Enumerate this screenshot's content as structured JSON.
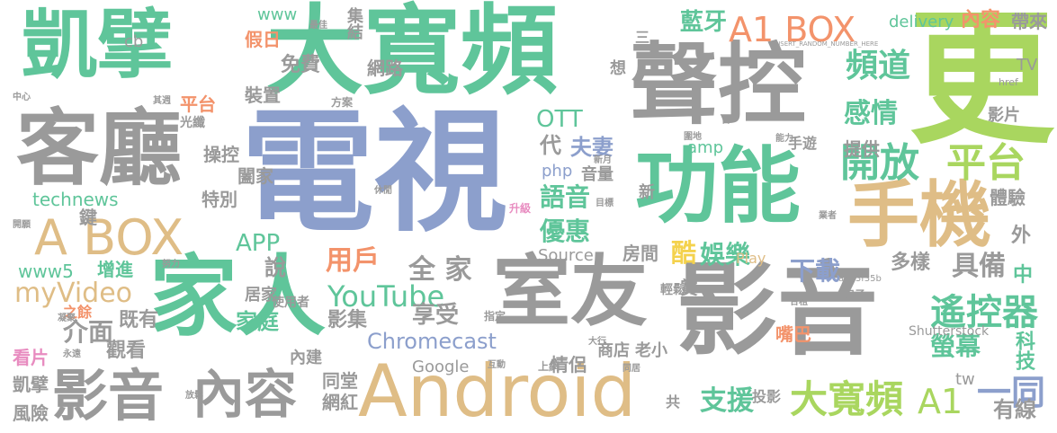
{
  "colors": {
    "gray": "#9a9a9a",
    "green": "#5fc59a",
    "blue": "#8c9fcc",
    "tan": "#dfbd86",
    "lime": "#a9d65f",
    "yellow": "#f4d24d",
    "orange": "#f3936b",
    "pink": "#e88cc0",
    "lightgray": "#c4c4c4"
  },
  "words": [
    {
      "text": "電視",
      "color": "blue"
    },
    {
      "text": "更",
      "color": "lime"
    },
    {
      "text": "影音",
      "color": "gray"
    },
    {
      "text": "大寬頻",
      "color": "green"
    },
    {
      "text": "凱擘",
      "color": "green"
    },
    {
      "text": "聲控",
      "color": "gray"
    },
    {
      "text": "家人",
      "color": "green"
    },
    {
      "text": "客廳",
      "color": "gray"
    },
    {
      "text": "功能",
      "color": "green"
    },
    {
      "text": "室友",
      "color": "gray"
    },
    {
      "text": "Android",
      "color": "tan"
    },
    {
      "text": "手機",
      "color": "tan"
    },
    {
      "text": "A BOX",
      "color": "tan"
    },
    {
      "text": "內容",
      "color": "gray"
    },
    {
      "text": "影音",
      "color": "gray"
    },
    {
      "text": "A1 BOX",
      "color": "orange"
    },
    {
      "text": "開放",
      "color": "green"
    },
    {
      "text": "平台",
      "color": "lime"
    },
    {
      "text": "遙控器",
      "color": "green"
    },
    {
      "text": "大寬頻",
      "color": "lime"
    },
    {
      "text": "A1",
      "color": "lime"
    },
    {
      "text": "一同",
      "color": "blue"
    },
    {
      "text": "YouTube",
      "color": "green"
    },
    {
      "text": "Chromecast",
      "color": "blue"
    },
    {
      "text": "myVideo",
      "color": "tan"
    },
    {
      "text": "technews",
      "color": "green"
    },
    {
      "text": "APP",
      "color": "green"
    },
    {
      "text": "OTT",
      "color": "green"
    },
    {
      "text": "藍牙",
      "color": "green"
    },
    {
      "text": "頻道",
      "color": "green"
    },
    {
      "text": "感情",
      "color": "green"
    },
    {
      "text": "語音",
      "color": "green"
    },
    {
      "text": "優惠",
      "color": "green"
    },
    {
      "text": "夫妻",
      "color": "blue"
    },
    {
      "text": "用戶",
      "color": "orange"
    },
    {
      "text": "全 家",
      "color": "gray"
    },
    {
      "text": "享受",
      "color": "gray"
    },
    {
      "text": "影集",
      "color": "gray"
    },
    {
      "text": "家庭",
      "color": "green"
    },
    {
      "text": "支援",
      "color": "green"
    },
    {
      "text": "娛樂",
      "color": "green"
    },
    {
      "text": "酷",
      "color": "yellow"
    },
    {
      "text": "房間",
      "color": "gray"
    },
    {
      "text": "下載",
      "color": "blue"
    },
    {
      "text": "螢幕",
      "color": "green"
    },
    {
      "text": "具備",
      "color": "gray"
    },
    {
      "text": "多樣",
      "color": "gray"
    },
    {
      "text": "科技",
      "color": "green"
    },
    {
      "text": "有線",
      "color": "gray"
    },
    {
      "text": "內容",
      "color": "orange"
    },
    {
      "text": "帶來",
      "color": "gray"
    },
    {
      "text": "delivery",
      "color": "green"
    },
    {
      "text": "集結",
      "color": "gray"
    },
    {
      "text": "www",
      "color": "green"
    },
    {
      "text": "網路",
      "color": "gray"
    },
    {
      "text": "免費",
      "color": "gray"
    },
    {
      "text": "假日",
      "color": "orange"
    },
    {
      "text": "裝置",
      "color": "gray"
    },
    {
      "text": "平台",
      "color": "orange"
    },
    {
      "text": "操控",
      "color": "gray"
    },
    {
      "text": "闔家",
      "color": "gray"
    },
    {
      "text": "特別",
      "color": "gray"
    },
    {
      "text": "說",
      "color": "gray"
    },
    {
      "text": "增進",
      "color": "green"
    },
    {
      "text": "www5",
      "color": "green"
    },
    {
      "text": "介面",
      "color": "gray"
    },
    {
      "text": "既有",
      "color": "gray"
    },
    {
      "text": "觀看",
      "color": "gray"
    },
    {
      "text": "凱擘",
      "color": "gray"
    },
    {
      "text": "風險",
      "color": "gray"
    },
    {
      "text": "看片",
      "color": "pink"
    },
    {
      "text": "內建",
      "color": "gray"
    },
    {
      "text": "同堂",
      "color": "gray"
    },
    {
      "text": "網紅",
      "color": "gray"
    },
    {
      "text": "Google",
      "color": "gray"
    },
    {
      "text": "情侶",
      "color": "gray"
    },
    {
      "text": "商店",
      "color": "gray"
    },
    {
      "text": "老小",
      "color": "gray"
    },
    {
      "text": "嘴巴",
      "color": "orange"
    },
    {
      "text": "Shutterstock",
      "color": "gray"
    },
    {
      "text": "使用者",
      "color": "gray"
    },
    {
      "text": "居家",
      "color": "gray"
    },
    {
      "text": "Source",
      "color": "gray"
    },
    {
      "text": "php",
      "color": "blue"
    },
    {
      "text": "音量",
      "color": "gray"
    },
    {
      "text": "amp",
      "color": "green"
    },
    {
      "text": "提供",
      "color": "gray"
    },
    {
      "text": "影片",
      "color": "gray"
    },
    {
      "text": "體驗",
      "color": "gray"
    },
    {
      "text": "TV",
      "color": "gray"
    },
    {
      "text": "中",
      "color": "green"
    },
    {
      "text": "tw",
      "color": "gray"
    },
    {
      "text": "外",
      "color": "gray"
    },
    {
      "text": "代",
      "color": "gray"
    },
    {
      "text": "鍵",
      "color": "gray"
    },
    {
      "text": "cb",
      "color": "gray"
    },
    {
      "text": "Play",
      "color": "tan"
    },
    {
      "text": "輕鬆",
      "color": "gray"
    },
    {
      "text": "賞",
      "color": "gray"
    },
    {
      "text": "手遊",
      "color": "gray"
    },
    {
      "text": "投影",
      "color": "gray"
    },
    {
      "text": "新",
      "color": "gray"
    },
    {
      "text": "之餘",
      "color": "orange"
    },
    {
      "text": "三",
      "color": "gray"
    },
    {
      "text": "想",
      "color": "gray"
    },
    {
      "text": "a4b3f35b",
      "color": "gray"
    },
    {
      "text": "光纖",
      "color": "gray"
    },
    {
      "text": "共",
      "color": "gray"
    },
    {
      "text": "上網",
      "color": "gray"
    },
    {
      "text": "互動",
      "color": "gray"
    },
    {
      "text": "指定",
      "color": "gray"
    },
    {
      "text": "升級",
      "color": "pink"
    },
    {
      "text": "方案",
      "color": "gray"
    },
    {
      "text": "href",
      "color": "gray"
    },
    {
      "text": "房子",
      "color": "gray"
    },
    {
      "text": "休閒",
      "color": "gray"
    },
    {
      "text": "新月",
      "color": "gray"
    },
    {
      "text": "目標",
      "color": "gray"
    },
    {
      "text": "大行",
      "color": "gray"
    },
    {
      "text": "能力",
      "color": "gray"
    },
    {
      "text": "放鬆",
      "color": "gray"
    },
    {
      "text": "永遠",
      "color": "gray"
    },
    {
      "text": "其週",
      "color": "gray"
    },
    {
      "text": "中心",
      "color": "gray"
    },
    {
      "text": "開願",
      "color": "gray"
    },
    {
      "text": "最佳",
      "color": "gray"
    },
    {
      "text": "努力",
      "color": "gray"
    },
    {
      "text": "同居",
      "color": "gray"
    },
    {
      "text": "業者",
      "color": "gray"
    },
    {
      "text": "合租",
      "color": "gray"
    },
    {
      "text": "凝聚",
      "color": "gray"
    },
    {
      "text": "圍地",
      "color": "gray"
    },
    {
      "text": "異",
      "color": "gray"
    },
    {
      "text": "日",
      "color": "gray"
    },
    {
      "text": "INSERT_RANDOM_NUMBER_HERE",
      "color": "gray"
    }
  ]
}
